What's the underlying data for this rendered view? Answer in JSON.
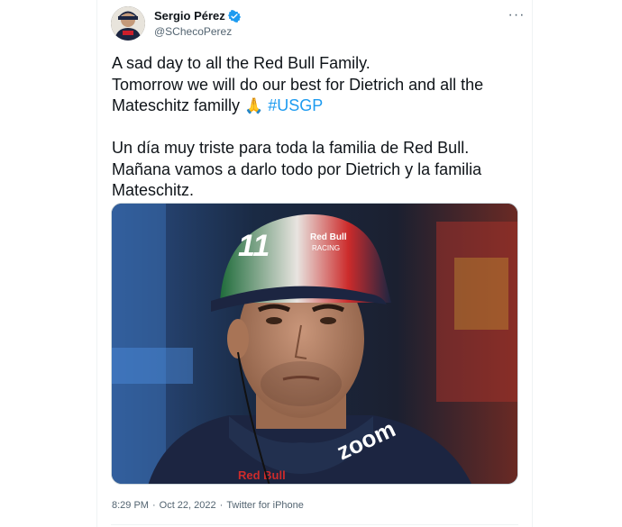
{
  "author": {
    "display_name": "Sergio Pérez",
    "handle": "@SChecoPerez",
    "verified": true,
    "avatar_icon": "avatar-photo"
  },
  "tweet": {
    "line1": "A sad day to all the Red Bull Family.",
    "line2": "Tomorrow we will do our best for Dietrich and all the",
    "line3_prefix": "Mateschitz familly",
    "line3_emoji": "🙏",
    "hashtag": "#USGP",
    "line4": "Un día muy triste para toda la familia de Red Bull.",
    "line5": "Mañana vamos a darlo todo por Dietrich y la familia",
    "line6": "Mateschitz."
  },
  "media": {
    "description_icon": "driver-portrait-photo",
    "cap_number": "11",
    "cap_text_top": "Red Bull",
    "cap_text_racing": "RACING",
    "suit_text": "zoom",
    "suit_brand": "Red Bull"
  },
  "meta": {
    "time": "8:29 PM",
    "separator": "·",
    "date": "Oct 22, 2022",
    "separator2": "·",
    "source": "Twitter for iPhone"
  },
  "colors": {
    "link": "#1d9bf0",
    "secondary": "#536471",
    "verified": "#1d9bf0"
  }
}
